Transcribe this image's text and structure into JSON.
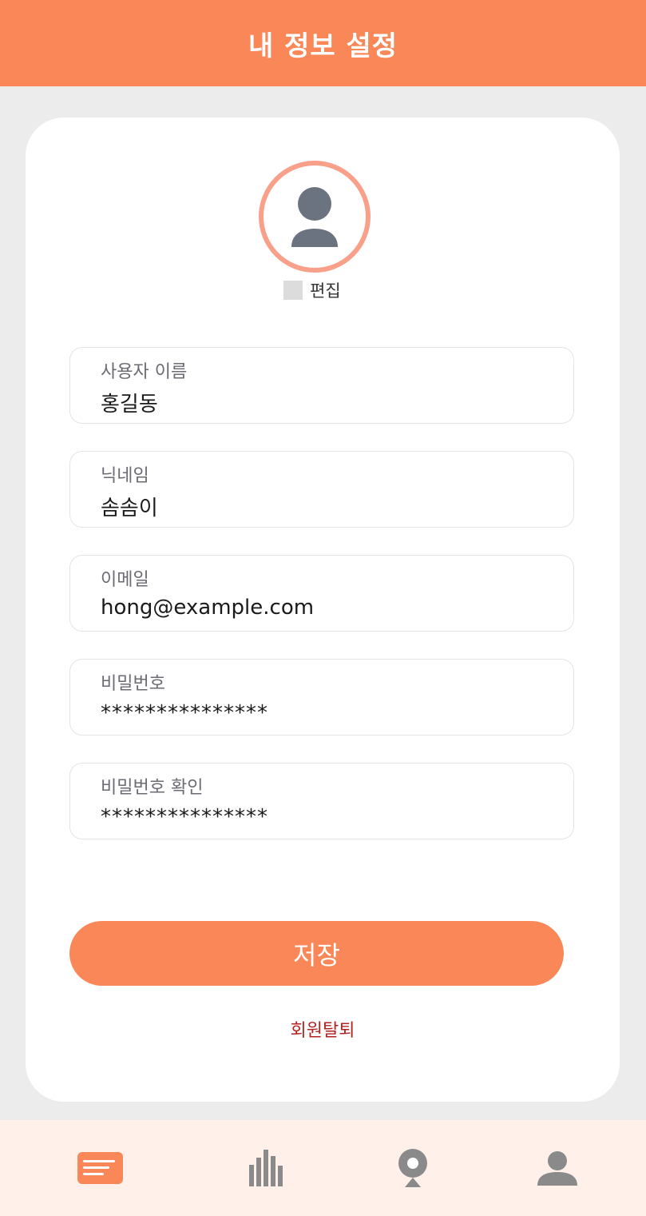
{
  "header": {
    "title": "내 정보 설정"
  },
  "profile": {
    "avatar_icon": "person-icon",
    "edit_label": "편집"
  },
  "form": {
    "fields": [
      {
        "label": "사용자 이름",
        "value": "홍길동"
      },
      {
        "label": "닉네임",
        "value": "솜솜이"
      },
      {
        "label": "이메일",
        "value": "hong@example.com"
      },
      {
        "label": "비밀번호",
        "value": "***************"
      },
      {
        "label": "비밀번호 확인",
        "value": "***************"
      }
    ],
    "save_label": "저장",
    "withdraw_label": "회원탈퇴"
  },
  "bottom_nav": {
    "items": [
      {
        "icon": "list-icon",
        "active": true
      },
      {
        "icon": "bar-chart-icon",
        "active": false
      },
      {
        "icon": "map-pin-icon",
        "active": false
      },
      {
        "icon": "person-icon",
        "active": false
      }
    ]
  },
  "colors": {
    "accent": "#fa8757",
    "avatar_ring": "#f9a08a",
    "nav_background": "#fff0e9",
    "danger_text": "#b42222",
    "inactive_icon": "#8a8a8a"
  }
}
